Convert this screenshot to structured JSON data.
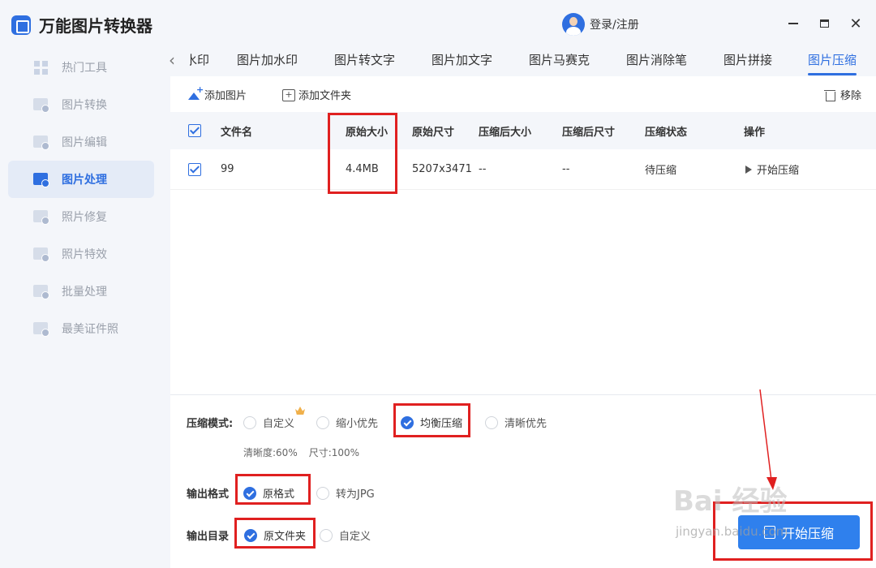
{
  "app": {
    "title": "万能图片转换器"
  },
  "window": {
    "login_label": "登录/注册",
    "close_glyph": "✕",
    "prev_glyph": "‹"
  },
  "sidebar": {
    "items": [
      {
        "label": "热门工具",
        "icon": "grid-icon"
      },
      {
        "label": "图片转换",
        "icon": "image-convert-icon"
      },
      {
        "label": "图片编辑",
        "icon": "image-edit-icon"
      },
      {
        "label": "图片处理",
        "icon": "image-process-icon",
        "active": true
      },
      {
        "label": "照片修复",
        "icon": "photo-repair-icon"
      },
      {
        "label": "照片特效",
        "icon": "photo-effect-icon"
      },
      {
        "label": "批量处理",
        "icon": "batch-icon"
      },
      {
        "label": "最美证件照",
        "icon": "id-photo-icon"
      }
    ]
  },
  "tabs": {
    "items": [
      "水印",
      "图片加水印",
      "图片转文字",
      "图片加文字",
      "图片马赛克",
      "图片消除笔",
      "图片拼接",
      "图片压缩"
    ],
    "active_index": 7
  },
  "toolbar": {
    "add_image": "添加图片",
    "add_folder": "添加文件夹",
    "remove": "移除"
  },
  "table": {
    "headers": [
      "文件名",
      "原始大小",
      "原始尺寸",
      "压缩后大小",
      "压缩后尺寸",
      "压缩状态",
      "操作"
    ],
    "rows": [
      {
        "name": "99",
        "size": "4.4MB",
        "dims": "5207x3471",
        "c_size": "--",
        "c_dims": "--",
        "status": "待压缩",
        "action": "开始压缩"
      }
    ]
  },
  "settings": {
    "mode_label": "压缩模式:",
    "modes": [
      "自定义",
      "缩小优先",
      "均衡压缩",
      "清晰优先"
    ],
    "mode_selected": "均衡压缩",
    "clarity": "清晰度:60%",
    "size": "尺寸:100%",
    "format_label": "输出格式",
    "formats": [
      "原格式",
      "转为JPG"
    ],
    "format_selected": "原格式",
    "dir_label": "输出目录",
    "dirs": [
      "原文件夹",
      "自定义"
    ],
    "dir_selected": "原文件夹"
  },
  "start_button": "开始压缩",
  "watermark": {
    "main": "Bai 经验",
    "sub": "jingyan.baidu.com"
  },
  "colors": {
    "accent": "#2f6fe0",
    "button": "#2f80ed",
    "highlight": "#e02020"
  }
}
